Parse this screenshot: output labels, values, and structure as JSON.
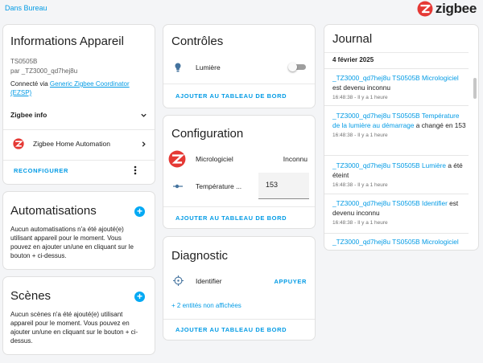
{
  "header": {
    "back_link": "Dans Bureau",
    "logo_text": "zigbee",
    "logo_color": "#e53935"
  },
  "device_info": {
    "title": "Informations Appareil",
    "model": "TS0505B",
    "manufacturer": "par _TZ3000_qd7hej8u",
    "connected_prefix": "Connecté via ",
    "coordinator_link": "Generic Zigbee Coordinator (EZSP)",
    "zigbee_info": "Zigbee info",
    "integration": "Zigbee Home Automation",
    "reconfigure": "RECONFIGURER"
  },
  "automations": {
    "title": "Automatisations",
    "text": "Aucun automatisations n'a été ajouté(e) utilisant appareil pour le moment. Vous pouvez en ajouter un/une en cliquant sur le bouton + ci-dessus."
  },
  "scenes": {
    "title": "Scènes",
    "text": "Aucun scènes n'a été ajouté(e) utilisant appareil pour le moment. Vous pouvez en ajouter un/une en cliquant sur le bouton + ci-dessus."
  },
  "controls": {
    "title": "Contrôles",
    "light_label": "Lumière",
    "light_on": false,
    "add_dashboard": "AJOUTER AU TABLEAU DE BORD"
  },
  "configuration": {
    "title": "Configuration",
    "firmware_label": "Micrologiciel",
    "firmware_value": "Inconnu",
    "temp_label": "Température ...",
    "temp_value": "153",
    "add_dashboard": "AJOUTER AU TABLEAU DE BORD"
  },
  "diagnostic": {
    "title": "Diagnostic",
    "identify_label": "Identifier",
    "identify_button": "APPUYER",
    "hidden_entities": "+ 2 entités non affichées",
    "add_dashboard": "AJOUTER AU TABLEAU DE BORD"
  },
  "journal": {
    "title": "Journal",
    "date": "4 février 2025",
    "entries": [
      {
        "entity": "_TZ3000_qd7hej8u TS0505B Micrologiciel",
        "message": "est devenu inconnu",
        "time": "16:48:38 - Il y a 1 heure"
      },
      {
        "entity": "_TZ3000_qd7hej8u TS0505B Température de la lumière au démarrage",
        "message": "a changé en 153",
        "time": "16:48:38 - Il y a 1 heure"
      },
      {
        "entity": "_TZ3000_qd7hej8u TS0505B Lumière",
        "message": "a été éteint",
        "time": "16:48:38 - Il y a 1 heure"
      },
      {
        "entity": "_TZ3000_qd7hej8u TS0505B Identifier",
        "message": "est devenu inconnu",
        "time": "16:48:38 - Il y a 1 heure"
      },
      {
        "entity": "_TZ3000_qd7hej8u TS0505B Micrologiciel",
        "message": "",
        "time": ""
      }
    ]
  },
  "colors": {
    "accent": "#039be5",
    "fab": "#03a9f4",
    "text": "#212121",
    "secondary": "#616161"
  }
}
